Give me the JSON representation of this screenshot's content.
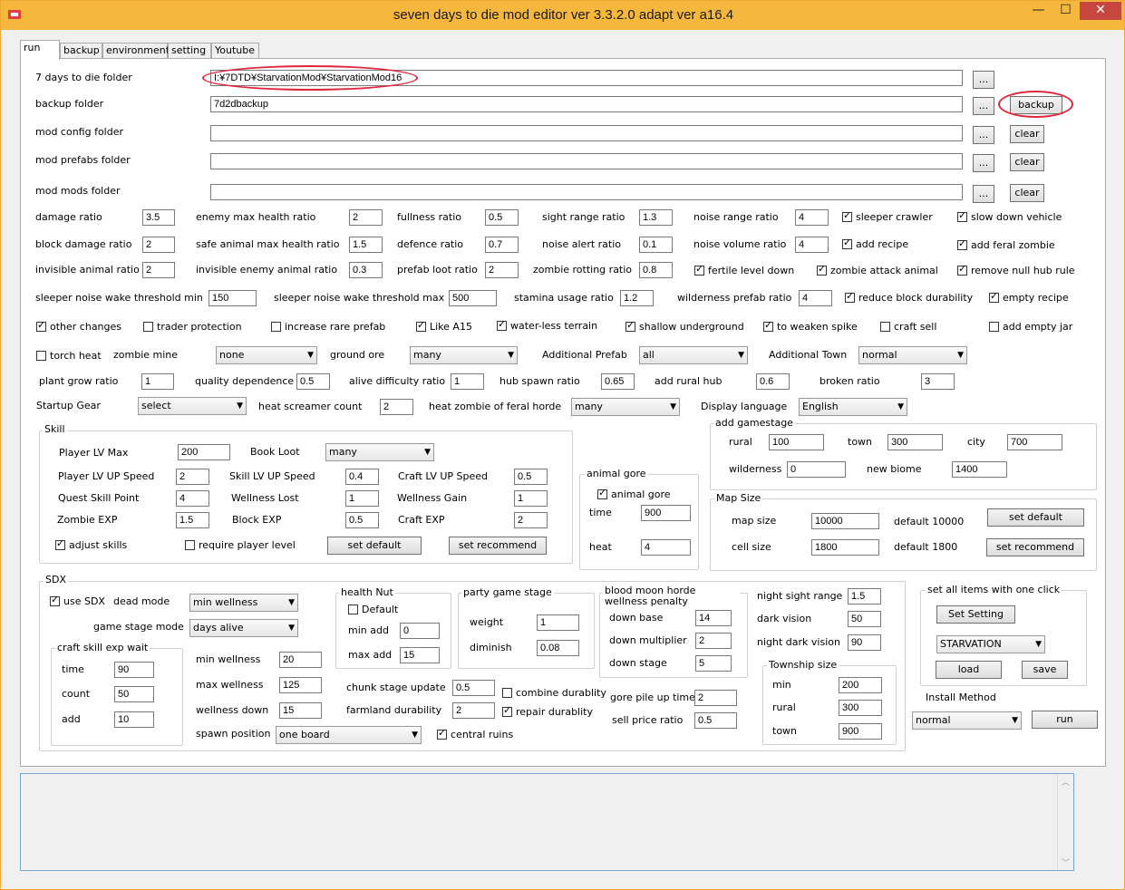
{
  "window": {
    "title": "seven days to die mod editor ver 3.3.2.0 adapt ver a16.4",
    "minimize": "—",
    "maximize": "☐",
    "close": "✕"
  },
  "tabs": [
    "run",
    "backup",
    "environment",
    "setting",
    "Youtube"
  ],
  "folders": {
    "sdtd_label": "7 days to die folder",
    "sdtd_value": "I:¥7DTD¥StarvationMod¥StarvationMod16",
    "backup_label": "backup folder",
    "backup_value": "7d2dbackup",
    "config_label": "mod config folder",
    "config_value": "",
    "prefabs_label": "mod prefabs folder",
    "prefabs_value": "",
    "mods_label": "mod mods folder",
    "mods_value": "",
    "browse": "...",
    "backup_btn": "backup",
    "clear_btn": "clear"
  },
  "ratios": {
    "damage_ratio": "damage ratio",
    "damage_ratio_v": "3.5",
    "enemy_max_health": "enemy max health ratio",
    "enemy_max_health_v": "2",
    "fullness": "fullness ratio",
    "fullness_v": "0.5",
    "sight_range": "sight range ratio",
    "sight_range_v": "1.3",
    "noise_range": "noise range ratio",
    "noise_range_v": "4",
    "block_damage": "block damage ratio",
    "block_damage_v": "2",
    "safe_animal": "safe animal max health ratio",
    "safe_animal_v": "1.5",
    "defence": "defence ratio",
    "defence_v": "0.7",
    "noise_alert": "noise alert ratio",
    "noise_alert_v": "0.1",
    "noise_volume": "noise volume ratio",
    "noise_volume_v": "4",
    "invisible_animal": "invisible animal ratio",
    "invisible_animal_v": "2",
    "invisible_enemy": "invisible enemy animal ratio",
    "invisible_enemy_v": "0.3",
    "prefab_loot": "prefab loot ratio",
    "prefab_loot_v": "2",
    "zombie_rotting": "zombie rotting ratio",
    "zombie_rotting_v": "0.8",
    "sleeper_min": "sleeper noise wake threshold min",
    "sleeper_min_v": "150",
    "sleeper_max": "sleeper noise wake threshold max",
    "sleeper_max_v": "500",
    "stamina": "stamina usage ratio",
    "stamina_v": "1.2",
    "wilderness_prefab": "wilderness prefab ratio",
    "wilderness_prefab_v": "4"
  },
  "checks": {
    "sleeper_crawler": "sleeper crawler",
    "slow_down_vehicle": "slow down vehicle",
    "add_recipe": "add recipe",
    "add_feral_zombie": "add feral zombie",
    "fertile_level_down": "fertile level down",
    "zombie_attack_animal": "zombie attack animal",
    "remove_null_hub": "remove null hub rule",
    "reduce_block_durability": "reduce block durability",
    "empty_recipe": "empty recipe",
    "other_changes": "other changes",
    "trader_protection": "trader protection",
    "increase_rare_prefab": "increase rare prefab",
    "like_a15": "Like A15",
    "waterless_terrain": "water-less terrain",
    "shallow_underground": "shallow underground",
    "to_weaken_spike": "to weaken spike",
    "craft_sell": "craft sell",
    "add_empty_jar": "add empty jar",
    "torch_heat": "torch heat"
  },
  "row_mine": {
    "zombie_mine": "zombie mine",
    "zombie_mine_v": "none",
    "ground_ore": "ground ore",
    "ground_ore_v": "many",
    "additional_prefab": "Additional Prefab",
    "additional_prefab_v": "all",
    "additional_town": "Additional Town",
    "additional_town_v": "normal"
  },
  "row_grow": {
    "plant_grow": "plant grow ratio",
    "plant_grow_v": "1",
    "quality_dep": "quality dependence",
    "quality_dep_v": "0.5",
    "alive_diff": "alive difficulty ratio",
    "alive_diff_v": "1",
    "hub_spawn": "hub spawn ratio",
    "hub_spawn_v": "0.65",
    "rural_hub": "add rural hub",
    "rural_hub_v": "0.6",
    "broken": "broken ratio",
    "broken_v": "3"
  },
  "row_gear": {
    "startup_gear": "Startup Gear",
    "startup_gear_v": "select",
    "heat_screamer": "heat screamer count",
    "heat_screamer_v": "2",
    "heat_zombie": "heat zombie of feral horde",
    "heat_zombie_v": "many",
    "display_lang": "Display language",
    "display_lang_v": "English"
  },
  "skill": {
    "title": "Skill",
    "player_lv_max": "Player LV Max",
    "player_lv_max_v": "200",
    "book_loot": "Book Loot",
    "book_loot_v": "many",
    "player_lv_up": "Player LV UP Speed",
    "player_lv_up_v": "2",
    "skill_lv_up": "Skill LV UP Speed",
    "skill_lv_up_v": "0.4",
    "craft_lv_up": "Craft LV UP Speed",
    "craft_lv_up_v": "0.5",
    "quest_skill": "Quest Skill Point",
    "quest_skill_v": "4",
    "wellness_lost": "Wellness Lost",
    "wellness_lost_v": "1",
    "wellness_gain": "Wellness Gain",
    "wellness_gain_v": "1",
    "zombie_exp": "Zombie EXP",
    "zombie_exp_v": "1.5",
    "block_exp": "Block EXP",
    "block_exp_v": "0.5",
    "craft_exp": "Craft EXP",
    "craft_exp_v": "2",
    "adjust_skills": "adjust skills",
    "require_player_level": "require player level",
    "set_default": "set default",
    "set_recommend": "set recommend"
  },
  "gore": {
    "title": "animal gore",
    "check": "animal gore",
    "time": "time",
    "time_v": "900",
    "heat": "heat",
    "heat_v": "4"
  },
  "gamestage": {
    "title": "add gamestage",
    "rural": "rural",
    "rural_v": "100",
    "town": "town",
    "town_v": "300",
    "city": "city",
    "city_v": "700",
    "wilderness": "wilderness",
    "wilderness_v": "0",
    "new_biome": "new biome",
    "new_biome_v": "1400"
  },
  "mapsize": {
    "title": "Map Size",
    "map_size": "map size",
    "map_size_v": "10000",
    "default_map": "default 10000",
    "cell_size": "cell size",
    "cell_size_v": "1800",
    "default_cell": "default 1800",
    "set_default": "set default",
    "set_recommend": "set recommend"
  },
  "sdx": {
    "title": "SDX",
    "use_sdx": "use SDX",
    "dead_mode": "dead mode",
    "dead_mode_v": "min wellness",
    "game_stage_mode": "game stage mode",
    "game_stage_mode_v": "days alive",
    "craft_title": "craft skill exp wait",
    "time": "time",
    "time_v": "90",
    "count": "count",
    "count_v": "50",
    "add": "add",
    "add_v": "10",
    "min_wellness": "min wellness",
    "min_wellness_v": "20",
    "max_wellness": "max wellness",
    "max_wellness_v": "125",
    "wellness_down": "wellness down",
    "wellness_down_v": "15",
    "spawn_position": "spawn position",
    "spawn_position_v": "one board",
    "central_ruins": "central ruins",
    "hn_title": "health Nut",
    "hn_default": "Default",
    "hn_min": "min add",
    "hn_min_v": "0",
    "hn_max": "max add",
    "hn_max_v": "15",
    "chunk_stage": "chunk stage update",
    "chunk_stage_v": "0.5",
    "farmland": "farmland durability",
    "farmland_v": "2",
    "combine": "combine durablity",
    "repair": "repair durablity",
    "pgs_title": "party game stage",
    "weight": "weight",
    "weight_v": "1",
    "diminish": "diminish",
    "diminish_v": "0.08",
    "bm_title": "blood moon horde wellness penalty",
    "down_base": "down base",
    "down_base_v": "14",
    "down_mult": "down multiplier",
    "down_mult_v": "2",
    "down_stage": "down stage",
    "down_stage_v": "5",
    "gore_pile": "gore pile up time",
    "gore_pile_v": "2",
    "sell_price": "sell price ratio",
    "sell_price_v": "0.5",
    "night_sight": "night sight range",
    "night_sight_v": "1.5",
    "dark_vision": "dark vision",
    "dark_vision_v": "50",
    "night_dark": "night dark vision",
    "night_dark_v": "90",
    "ts_title": "Township size",
    "ts_min": "min",
    "ts_min_v": "200",
    "ts_rural": "rural",
    "ts_rural_v": "300",
    "ts_town": "town",
    "ts_town_v": "900"
  },
  "setall": {
    "title": "set all items with one click",
    "set_setting": "Set Setting",
    "preset_v": "STARVATION",
    "load": "load",
    "save": "save",
    "install_method": "Install Method",
    "install_v": "normal",
    "run": "run"
  },
  "log": {
    "text": ""
  },
  "colors": {
    "titlebar": "#f5b83d",
    "close": "#c7463f",
    "annotation_ring": "#e0263a"
  }
}
